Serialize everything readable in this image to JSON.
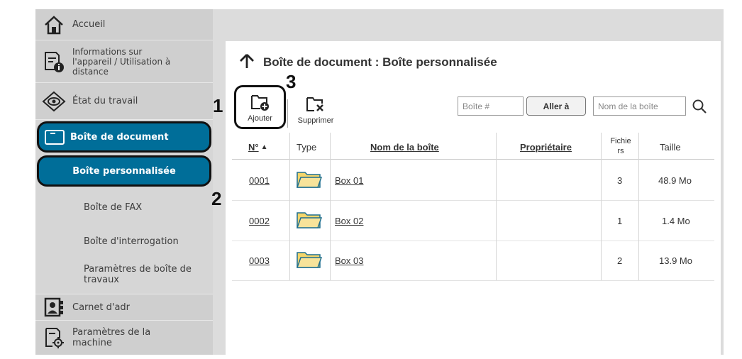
{
  "sidebar": {
    "items": [
      {
        "label": "Accueil",
        "icon": "home-icon"
      },
      {
        "label": "Informations sur l'appareil / Utilisation à distance",
        "icon": "device-info-icon"
      },
      {
        "label": "État du travail",
        "icon": "eye-icon"
      },
      {
        "label": "Boîte de document",
        "icon": "folder-icon"
      },
      {
        "label": "Carnet d'adr",
        "icon": "address-book-icon"
      },
      {
        "label": "Paramètres de la machine",
        "icon": "machine-settings-icon"
      }
    ],
    "info_lines": [
      "Informations sur",
      "l'appareil / Utilisation à",
      "distance"
    ],
    "machine_lines": [
      "Paramètres de la",
      "machine"
    ],
    "subitems": [
      {
        "label": "Boîte personnalisée"
      },
      {
        "label": "Boîte de FAX"
      },
      {
        "label": "Boîte d'interrogation"
      },
      {
        "label_lines": [
          "Paramètres de boîte de",
          "travaux"
        ]
      }
    ]
  },
  "callouts": [
    "1",
    "2",
    "3"
  ],
  "main": {
    "title": "Boîte de document : Boîte personnalisée",
    "toolbar": {
      "add_label": "Ajouter",
      "delete_label": "Supprimer"
    },
    "search": {
      "box_number_placeholder": "Boîte #",
      "go_label": "Aller à",
      "box_name_placeholder": "Nom de la boîte"
    },
    "table": {
      "headers": {
        "no": "N°",
        "type": "Type",
        "name": "Nom de la boîte",
        "owner": "Propriétaire",
        "files_lines": [
          "Fichie",
          "rs"
        ],
        "size": "Taille"
      },
      "sort_indicator": "▲",
      "rows": [
        {
          "no": "0001",
          "name": "Box 01",
          "owner": "",
          "files": "3",
          "size": "48.9 Mo"
        },
        {
          "no": "0002",
          "name": "Box 02",
          "owner": "",
          "files": "1",
          "size": "1.4 Mo"
        },
        {
          "no": "0003",
          "name": "Box 03",
          "owner": "",
          "files": "2",
          "size": "13.9 Mo"
        }
      ]
    }
  },
  "colors": {
    "selected": "#006e99",
    "sidebar": "#d6d6d6",
    "folder": "#f3d56b"
  }
}
